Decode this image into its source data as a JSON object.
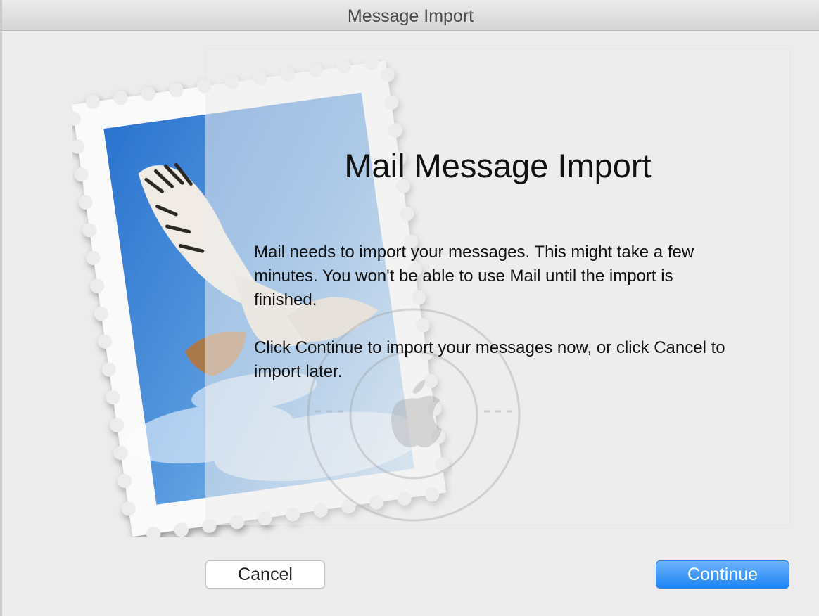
{
  "window": {
    "title": "Message Import"
  },
  "dialog": {
    "heading": "Mail Message Import",
    "paragraph_1": "Mail needs to import your messages. This might take a few minutes. You won't be able to use Mail until the import is finished.",
    "paragraph_2": "Click Continue to import your messages now, or click Cancel to import later."
  },
  "buttons": {
    "cancel_label": "Cancel",
    "continue_label": "Continue"
  },
  "icons": {
    "stamp": "mail-stamp-icon",
    "postmark": "postmark-icon",
    "bird": "hawk-icon"
  },
  "colors": {
    "accent": "#1f84f5",
    "window_bg": "#ececec",
    "stamp_sky": "#3f86d8"
  }
}
